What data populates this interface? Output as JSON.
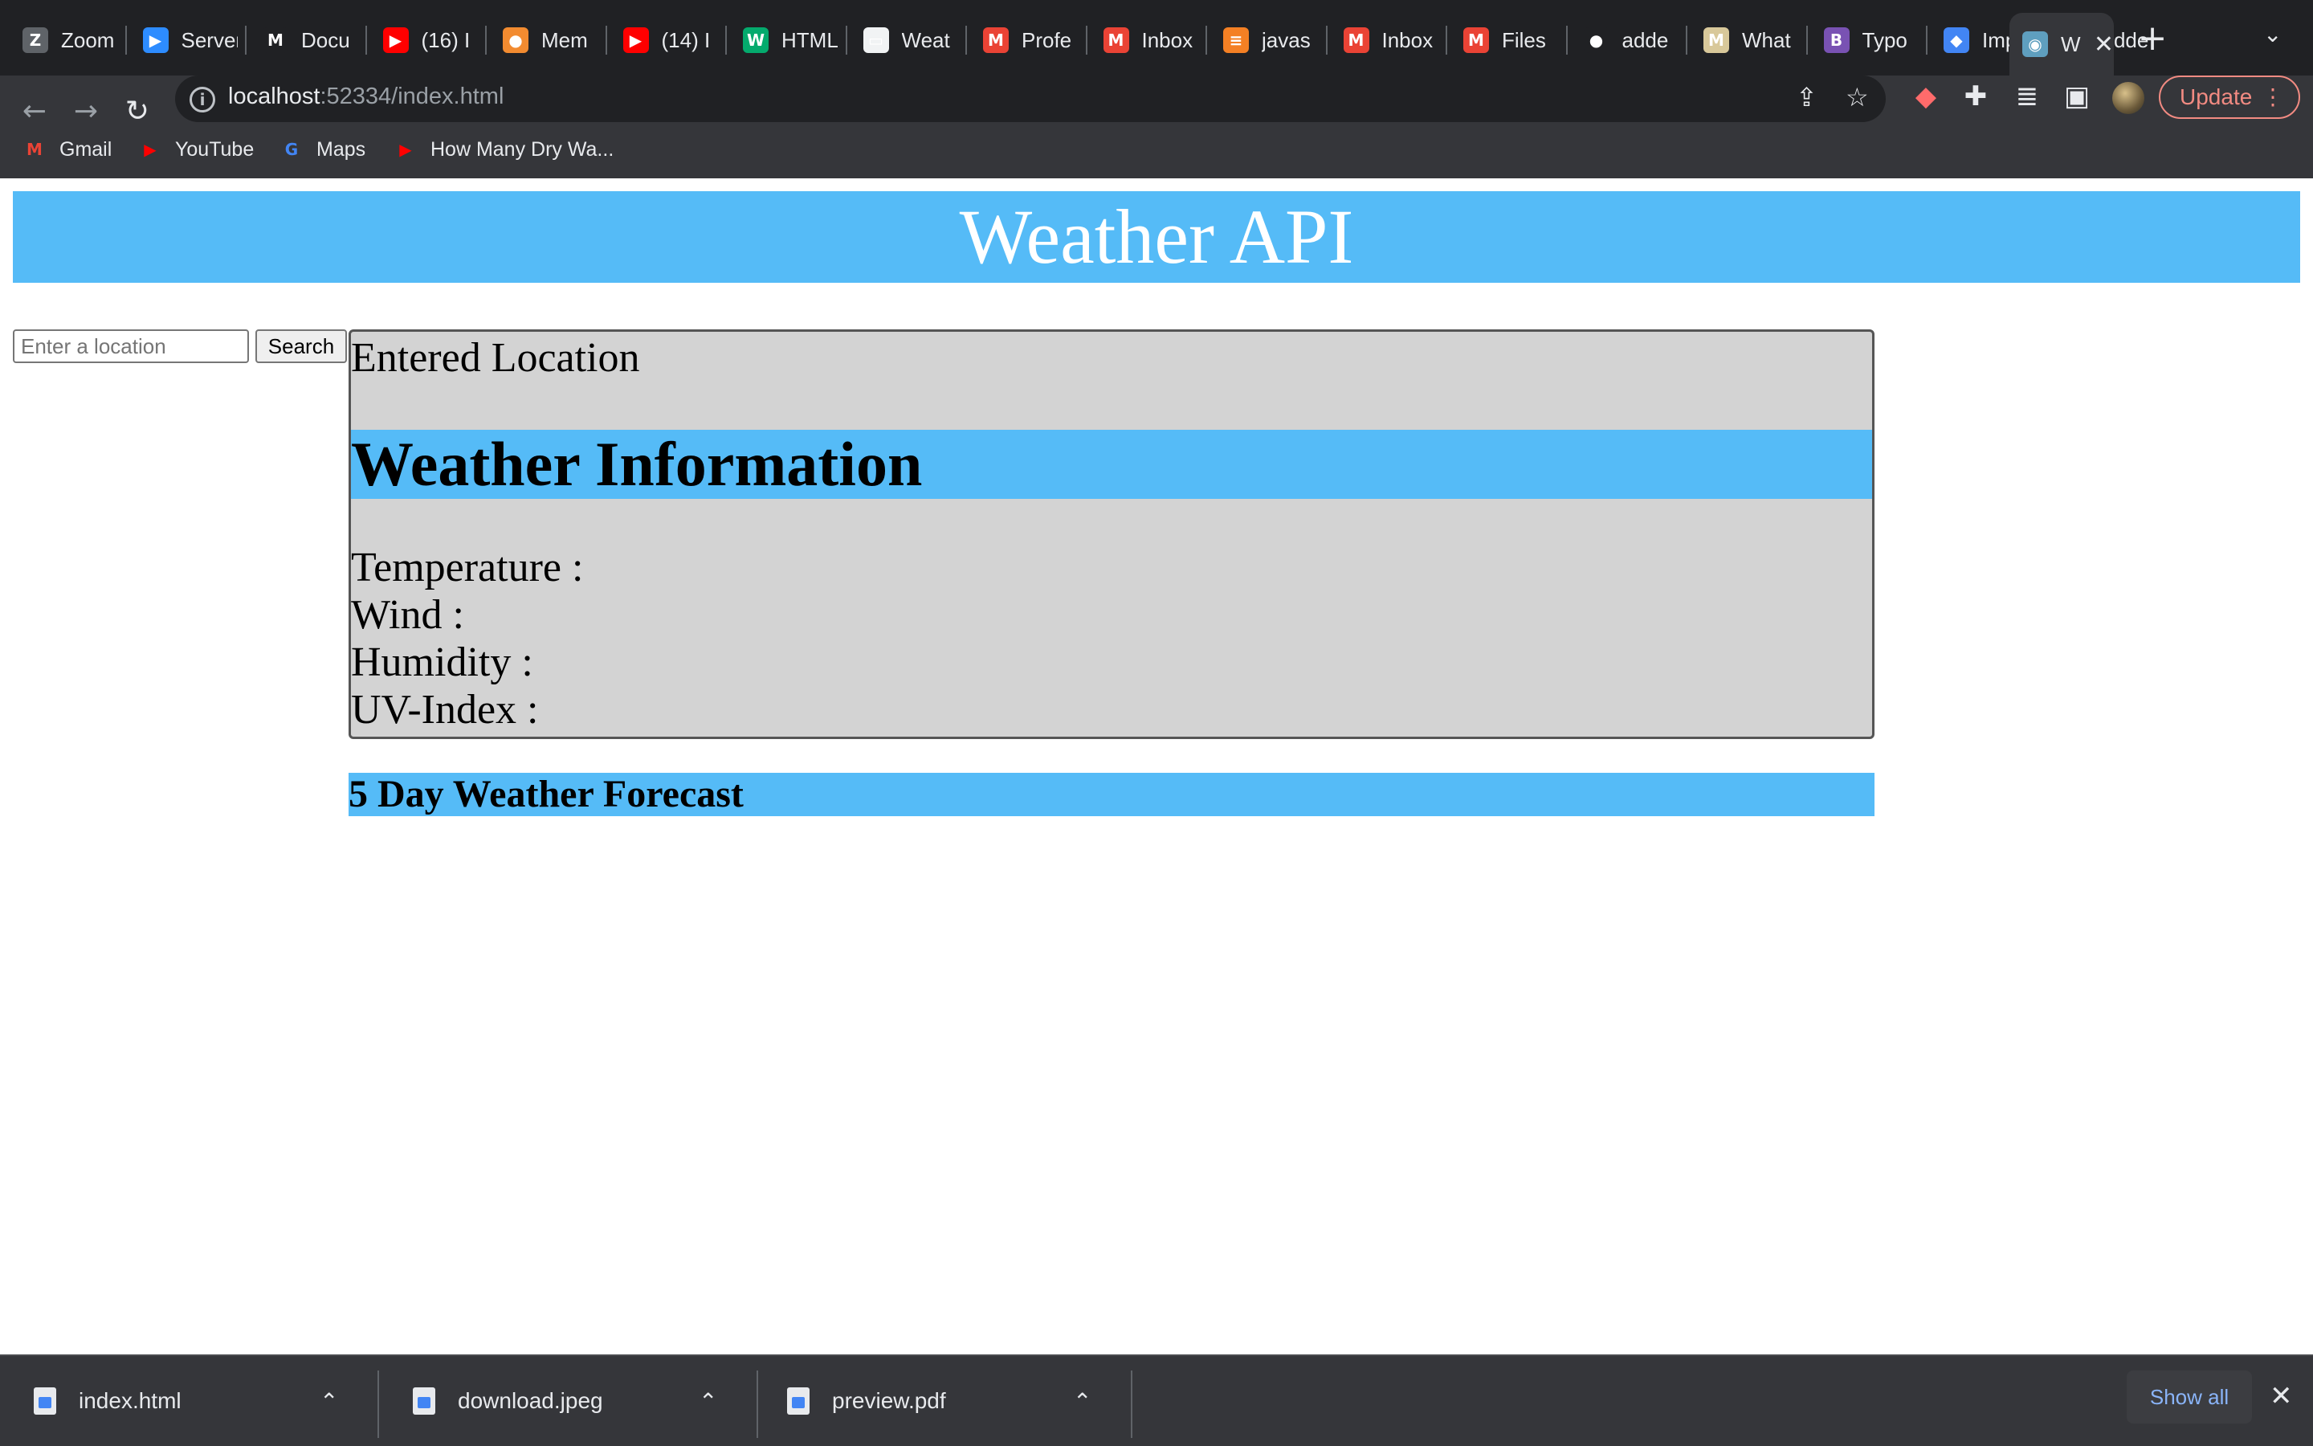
{
  "browser": {
    "tabs": [
      {
        "title": "Zoom",
        "icon": "zoom-icon",
        "color": "#5f6368",
        "glyph": "Z"
      },
      {
        "title": "Server",
        "icon": "zoom-video-icon",
        "color": "#2d8cff",
        "glyph": "▶"
      },
      {
        "title": "Docu",
        "icon": "medium-icon",
        "color": "#202124",
        "glyph": "M"
      },
      {
        "title": "(16) I",
        "icon": "youtube-icon",
        "color": "#ff0000",
        "glyph": "▶"
      },
      {
        "title": "Mem",
        "icon": "meme-icon",
        "color": "#f28b30",
        "glyph": "●"
      },
      {
        "title": "(14) I",
        "icon": "youtube-icon",
        "color": "#ff0000",
        "glyph": "▶"
      },
      {
        "title": "HTML",
        "icon": "w3schools-icon",
        "color": "#04aa6d",
        "glyph": "W"
      },
      {
        "title": "Weat",
        "icon": "document-icon",
        "color": "#f1f3f4",
        "glyph": "▭"
      },
      {
        "title": "Profe",
        "icon": "gmail-icon",
        "color": "#ea4335",
        "glyph": "M"
      },
      {
        "title": "Inbox",
        "icon": "gmail-icon",
        "color": "#ea4335",
        "glyph": "M"
      },
      {
        "title": "javas",
        "icon": "stackoverflow-icon",
        "color": "#f48024",
        "glyph": "≡"
      },
      {
        "title": "Inbox",
        "icon": "gmail-icon",
        "color": "#ea4335",
        "glyph": "M"
      },
      {
        "title": "Files",
        "icon": "gmail-icon",
        "color": "#ea4335",
        "glyph": "M"
      },
      {
        "title": "adde",
        "icon": "github-icon",
        "color": "#202124",
        "glyph": "●"
      },
      {
        "title": "What",
        "icon": "m-logo-icon",
        "color": "#d8c89a",
        "glyph": "M"
      },
      {
        "title": "Typo",
        "icon": "bootstrap-icon",
        "color": "#7952b3",
        "glyph": "B"
      },
      {
        "title": "Impo",
        "icon": "app-icon",
        "color": "#4285f4",
        "glyph": "◆"
      },
      {
        "title": "adde",
        "icon": "github-icon",
        "color": "#e8eaed",
        "glyph": "●"
      },
      {
        "title": "W",
        "icon": "globe-icon",
        "color": "#5f9fbf",
        "glyph": "◉"
      }
    ],
    "url_host": "localhost",
    "url_path": ":52334/index.html",
    "update_label": "Update",
    "bookmarks": [
      {
        "label": "Gmail",
        "icon": "gmail-icon",
        "color": "#ea4335",
        "glyph": "M"
      },
      {
        "label": "YouTube",
        "icon": "youtube-icon",
        "color": "#ff0000",
        "glyph": "▶"
      },
      {
        "label": "Maps",
        "icon": "google-icon",
        "color": "#4285f4",
        "glyph": "G"
      },
      {
        "label": "How Many Dry Wa...",
        "icon": "youtube-icon",
        "color": "#ff0000",
        "glyph": "▶"
      }
    ]
  },
  "page": {
    "title": "Weather API",
    "search": {
      "placeholder": "Enter a location",
      "value": "",
      "button_label": "Search"
    },
    "entered_location": "Entered Location",
    "weather_heading": "Weather Information",
    "stats": {
      "temperature": "Temperature :",
      "wind": "Wind :",
      "humidity": "Humidity :",
      "uv_index": "UV-Index :"
    },
    "forecast_heading": "5 Day Weather Forecast",
    "colors": {
      "accent": "#55bbf7",
      "card_bg": "#d3d3d3"
    }
  },
  "downloads": {
    "items": [
      {
        "name": "index.html"
      },
      {
        "name": "download.jpeg"
      },
      {
        "name": "preview.pdf"
      }
    ],
    "show_all_label": "Show all"
  }
}
